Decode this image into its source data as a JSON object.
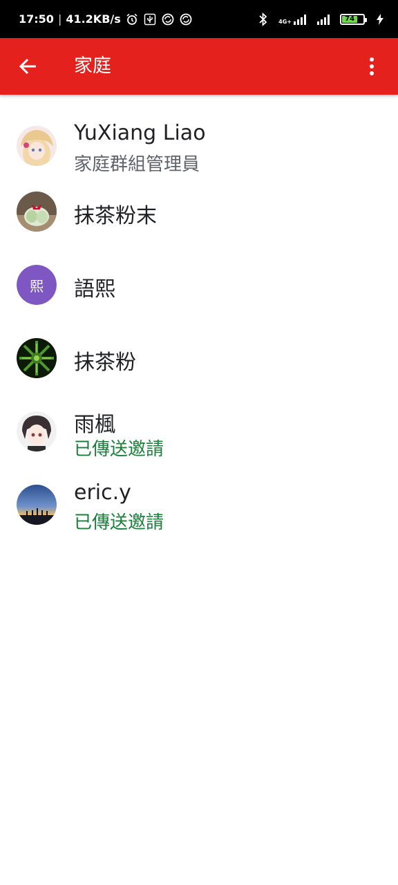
{
  "status_bar": {
    "time": "17:50",
    "separator": "|",
    "net_speed": "41.2KB/s",
    "icons": [
      "alarm-icon",
      "usb-icon",
      "sync-icon",
      "sync-icon"
    ],
    "network_type": "4G+",
    "battery_level": "74",
    "battery_percent": 74
  },
  "app_bar": {
    "title": "家庭",
    "back_icon": "arrow-back-icon",
    "menu_icon": "more-vert-icon"
  },
  "members": [
    {
      "name": "YuXiang Liao",
      "subtitle": "家庭群組管理員",
      "status": "admin"
    },
    {
      "name": "抹茶粉末",
      "subtitle": ""
    },
    {
      "name": "語熙",
      "subtitle": "",
      "avatar_letter": "熙"
    },
    {
      "name": "抹茶粉",
      "subtitle": ""
    },
    {
      "name": "雨楓",
      "subtitle": "已傳送邀請",
      "status": "invited"
    },
    {
      "name": "eric.y",
      "subtitle": "已傳送邀請",
      "status": "invited"
    }
  ],
  "colors": {
    "app_bar": "#e5211d",
    "invited_text": "#188038",
    "secondary_text": "#5f6368",
    "letter_avatar": "#7e57c2"
  }
}
